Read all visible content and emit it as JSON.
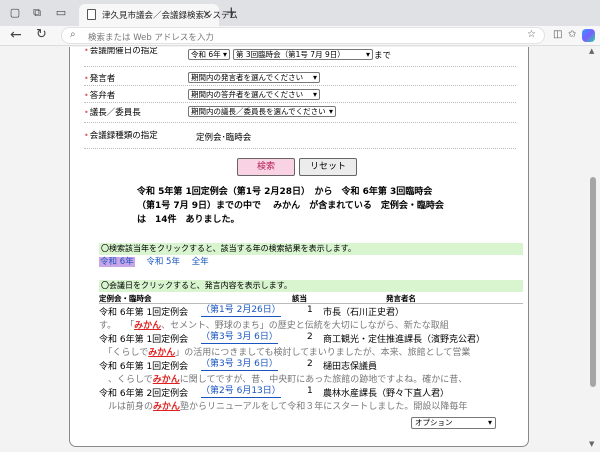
{
  "browser": {
    "tab_title": "津久見市議会／会議録検索システム",
    "address_placeholder": "検索または Web アドレスを入力"
  },
  "form": {
    "date_label": "会議開催日の指定",
    "date_from_top": "令和 6年",
    "date_from_top2": "第 3回臨時会（第1号 7月 9日）",
    "date_to_suffix": "まで",
    "speaker_label": "発言者",
    "speaker_select": "期間内の発言者を選んでください",
    "answerer_label": "答弁者",
    "answerer_select": "期間内の答弁者を選んでください",
    "chair_label": "議長／委員長",
    "chair_select": "期間内の議長／委員長を選んでください",
    "type_label": "会議録種類の指定",
    "type_value": "定例会･臨時会",
    "search_button": "検索",
    "reset_button": "リセット"
  },
  "summary": {
    "line1": "令和 5年第 1回定例会（第1号 2月28日）　から　令和 6年第 3回臨時会",
    "line2": "（第1号 7月 9日）までの中で　 みかん　が含まれている　定例会・臨時会",
    "line3": "は　14件　ありました。"
  },
  "year_section": {
    "hint": "〇検索該当年をクリックすると、該当する年の検索結果を表示します。",
    "years": [
      "令和 6年",
      "令和 5年",
      "全年"
    ]
  },
  "results": {
    "hint": "〇会議日をクリックすると、発言内容を表示します。",
    "headers": {
      "session": "定例会・臨時会",
      "number": "該当",
      "speaker": "発言者名"
    },
    "records": [
      {
        "session": "令和 6年第 1回定例会",
        "link": "（第1号 2月26日）",
        "no": "1",
        "speaker": "市長（石川正史君）",
        "snippet_pre": "す。　　「",
        "keyword": "みかん",
        "snippet_post": "、セメント、野球のまち」の歴史と伝統を大切にしながら、新たな取組"
      },
      {
        "session": "令和 6年第 1回定例会",
        "link": "（第3号 3月 6日）",
        "no": "2",
        "speaker": "商工観光・定住推進課長（濱野克公君）",
        "snippet_pre": "　「くらしで",
        "keyword": "みかん",
        "snippet_post": "」の活用につきましても検討してまいりましたが、本来、旅館として営業"
      },
      {
        "session": "令和 6年第 1回定例会",
        "link": "（第3号 3月 6日）",
        "no": "2",
        "speaker": "樋田志保議員",
        "snippet_pre": "　、くらしで",
        "keyword": "みかん",
        "snippet_post": "に関してですが、昔、中央町にあった旅館の跡地ですよね。確かに昔、"
      },
      {
        "session": "令和 6年第 2回定例会",
        "link": "（第2号 6月13日）",
        "no": "1",
        "speaker": "農林水産課長（野々下直人君）",
        "snippet_pre": "　ルは前身の",
        "keyword": "みかん",
        "snippet_post": "塾からリニューアルをして令和３年にスタートしました。開設以降毎年"
      }
    ]
  },
  "option_select": "オプション"
}
